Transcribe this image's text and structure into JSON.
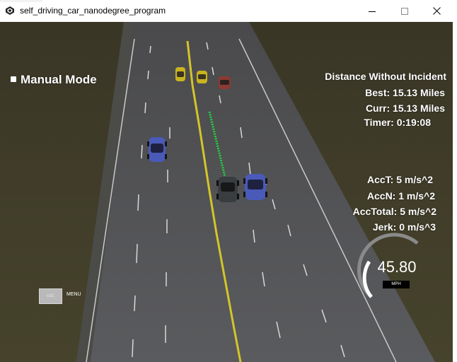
{
  "window": {
    "title": "self_driving_car_nanodegree_program",
    "controls": [
      "minimize-icon",
      "maximize-icon",
      "close-icon"
    ]
  },
  "hud": {
    "mode_label": "Manual Mode",
    "distance_heading": "Distance Without Incident",
    "best": "Best: 15.13 Miles",
    "curr": "Curr: 15.13 Miles",
    "timer": "Timer: 0:19:08",
    "acc_t": "AccT: 5 m/s^2",
    "acc_n": "AccN: 1 m/s^2",
    "acc_total": "AccTotal: 5 m/s^2",
    "jerk": "Jerk: 0 m/s^3"
  },
  "speedometer": {
    "value": "45.80",
    "unit": "MPH",
    "level_fraction": 0.46
  },
  "menu": {
    "esc_label": "ESC",
    "menu_label": "MENU"
  },
  "scene": {
    "cars": [
      {
        "name": "yellow-car-1",
        "color": "#c9b320"
      },
      {
        "name": "yellow-car-2",
        "color": "#c9b320"
      },
      {
        "name": "red-car",
        "color": "#8c3a32"
      },
      {
        "name": "blue-car-left",
        "color": "#4a5ab8"
      },
      {
        "name": "ego-car",
        "color": "#3a3d3f"
      },
      {
        "name": "blue-car-right",
        "color": "#4a5ab8"
      }
    ],
    "colors": {
      "grass": "#3f3b27",
      "road": "#55565a",
      "center_line": "#d4c52a",
      "path": "#22d040"
    }
  }
}
